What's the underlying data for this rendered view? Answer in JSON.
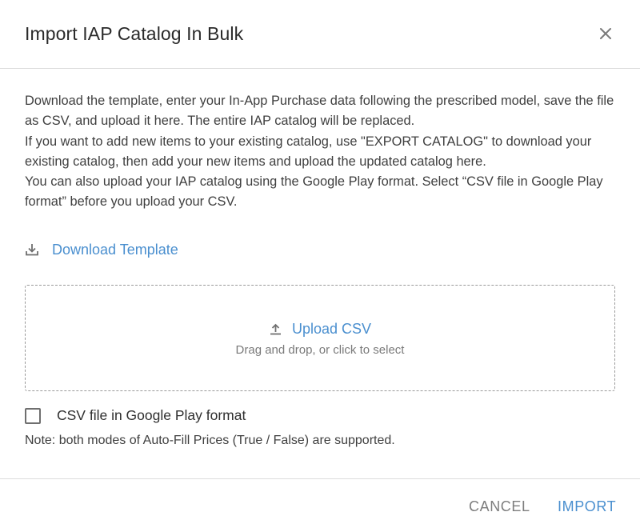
{
  "dialog": {
    "title": "Import IAP Catalog In Bulk",
    "close_icon": "close-icon"
  },
  "description": {
    "paragraphs": [
      "Download the template, enter your In-App Purchase data following the prescribed model, save the file as CSV, and upload it here. The entire IAP catalog will be replaced.",
      "If you want to add new items to your existing catalog, use \"EXPORT CATALOG\" to download your existing catalog, then add your new items and upload the updated catalog here.",
      "You can also upload your IAP catalog using the Google Play format. Select “CSV file in Google Play format” before you upload your CSV."
    ]
  },
  "download": {
    "icon": "download-icon",
    "label": "Download Template"
  },
  "upload": {
    "icon": "upload-icon",
    "label": "Upload CSV",
    "hint": "Drag and drop, or click to select"
  },
  "checkbox": {
    "label": "CSV file in Google Play format",
    "checked": false
  },
  "note": "Note: both modes of Auto-Fill Prices (True / False) are supported.",
  "footer": {
    "cancel_label": "CANCEL",
    "import_label": "IMPORT"
  },
  "colors": {
    "accent": "#4a8fcf",
    "muted": "#7d7d7d",
    "divider": "#dcdcdc"
  }
}
